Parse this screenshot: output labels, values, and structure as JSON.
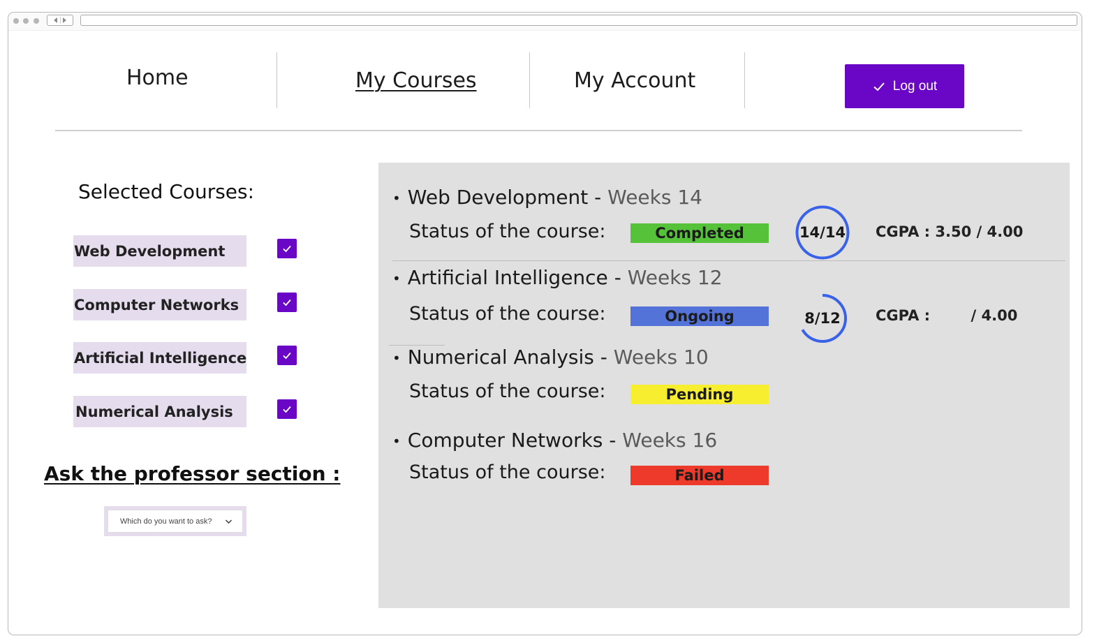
{
  "nav": {
    "home": "Home",
    "my_courses": "My Courses",
    "my_account": "My Account",
    "logout": "Log out"
  },
  "sidebar": {
    "title": "Selected Courses:",
    "courses": [
      {
        "label": "Web Development",
        "checked": true
      },
      {
        "label": "Computer Networks",
        "checked": true
      },
      {
        "label": "Artificial Intelligence",
        "checked": true
      },
      {
        "label": "Numerical Analysis",
        "checked": true
      }
    ],
    "ask_title": "Ask the professor section :",
    "ask_select": "Which do you want to ask?"
  },
  "courses": [
    {
      "name": "Web Development",
      "weeks": "Weeks 14",
      "status_label": "Status of the course:",
      "status": "Completed",
      "status_color": "#55c23a",
      "progress_text": "14/14",
      "progress": 1.0,
      "cgpa_label": "CGPA : 3.50 / 4.00"
    },
    {
      "name": "Artificial Intelligence",
      "weeks": "Weeks 12",
      "status_label": "Status of the course:",
      "status": "Ongoing",
      "status_color": "#5473d8",
      "progress_text": "8/12",
      "progress": 0.6667,
      "cgpa_label": "CGPA :        / 4.00"
    },
    {
      "name": "Numerical Analysis",
      "weeks": "Weeks 10",
      "status_label": "Status of the course:",
      "status": "Pending",
      "status_color": "#f8ee30"
    },
    {
      "name": "Computer Networks",
      "weeks": "Weeks 16",
      "status_label": "Status of the course:",
      "status": "Failed",
      "status_color": "#ee3a2a"
    }
  ],
  "colors": {
    "accent": "#6a06c6",
    "ring": "#3a62e8",
    "panel": "#e0e0e0",
    "chip": "#e5dcee"
  },
  "icons": {
    "logout": "check-icon",
    "checkbox": "check-icon",
    "select": "chevron-down-icon"
  }
}
